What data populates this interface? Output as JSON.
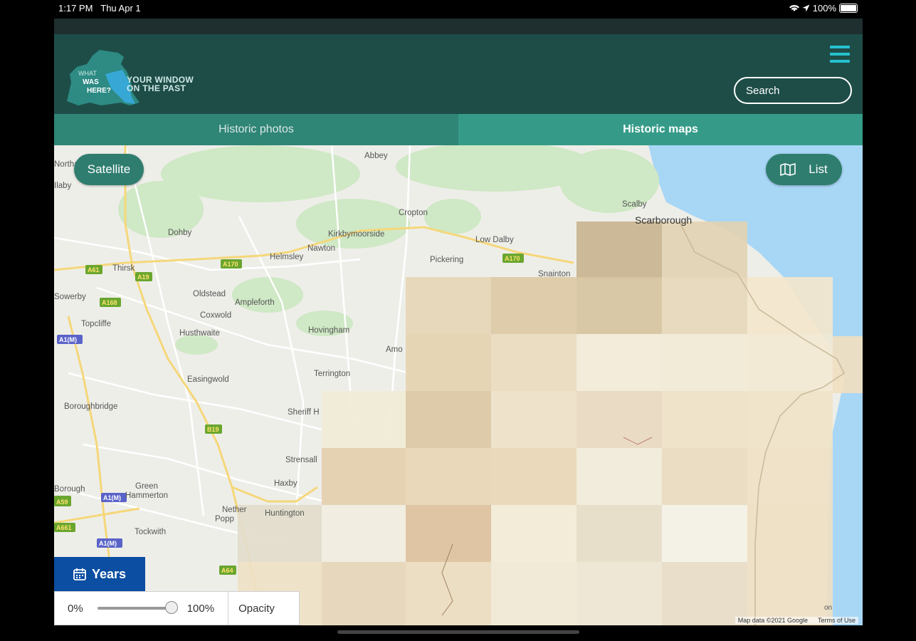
{
  "status_bar": {
    "time": "1:17 PM",
    "date": "Thu Apr 1",
    "battery": "100%"
  },
  "brand": {
    "logo_text": "WHAT WAS HERE?",
    "tagline_line1": "YOUR WINDOW",
    "tagline_line2": "ON THE PAST"
  },
  "search": {
    "placeholder": "Search"
  },
  "tabs": [
    {
      "label": "Historic photos"
    },
    {
      "label": "Historic maps"
    }
  ],
  "map": {
    "satellite_label": "Satellite",
    "list_label": "List",
    "place_labels": [
      {
        "text": "Northall"
      },
      {
        "text": "Abbey"
      },
      {
        "text": "Ilaby"
      },
      {
        "text": "Cropton"
      },
      {
        "text": "Scalby"
      },
      {
        "text": "Scarborough"
      },
      {
        "text": "Dohby"
      },
      {
        "text": "Kirkbymoorside"
      },
      {
        "text": "Nawton"
      },
      {
        "text": "Helmsley"
      },
      {
        "text": "Low Dalby"
      },
      {
        "text": "Pickering"
      },
      {
        "text": "Thirsk"
      },
      {
        "text": "Snainton"
      },
      {
        "text": "Oldstead"
      },
      {
        "text": "Ampleforth"
      },
      {
        "text": "Sowerby"
      },
      {
        "text": "Coxwold"
      },
      {
        "text": "Topcliffe"
      },
      {
        "text": "Husthwaite"
      },
      {
        "text": "Hovingham"
      },
      {
        "text": "Amo"
      },
      {
        "text": "Easingwold"
      },
      {
        "text": "Terrington"
      },
      {
        "text": "Boroughbridge"
      },
      {
        "text": "Sheriff H"
      },
      {
        "text": "Strensall"
      },
      {
        "text": "Haxby"
      },
      {
        "text": "Green Hammerton"
      },
      {
        "text": "Nether Popp"
      },
      {
        "text": "Huntington"
      },
      {
        "text": "Tockwith"
      },
      {
        "text": "Borough"
      }
    ],
    "road_labels": [
      {
        "text": "A61"
      },
      {
        "text": "A19"
      },
      {
        "text": "A170"
      },
      {
        "text": "A170"
      },
      {
        "text": "A168"
      },
      {
        "text": "A1(M)"
      },
      {
        "text": "B19"
      },
      {
        "text": "A1(M)"
      },
      {
        "text": "A1(M)"
      },
      {
        "text": "A59"
      },
      {
        "text": "A64"
      },
      {
        "text": "A661"
      },
      {
        "text": "A59"
      }
    ],
    "attribution": "Map data ©2021 Google",
    "terms": "Terms of Use",
    "corner_text": "on"
  },
  "years_label": "Years",
  "opacity": {
    "min_label": "0%",
    "max_label": "100%",
    "value_percent": 100,
    "button_label": "Opacity"
  },
  "colors": {
    "header": "#1e4d48",
    "tab_active": "#359b88",
    "tab_inactive": "#2f8576",
    "accent": "#27c1d1",
    "years": "#0b4ea2",
    "water": "#a8d6f5"
  }
}
